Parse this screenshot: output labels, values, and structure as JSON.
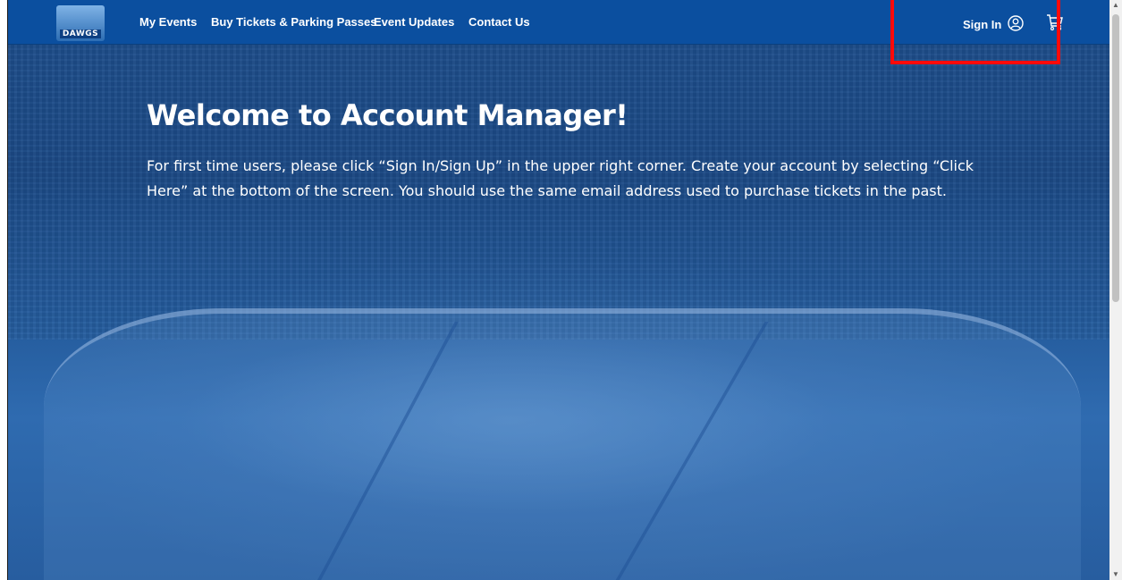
{
  "navbar": {
    "logo_text": "DAWGS",
    "links": [
      "My Events",
      "Buy Tickets & Parking Passes",
      "Event Updates",
      "Contact Us"
    ],
    "sign_in_label": "Sign In",
    "icons": {
      "account": "user-circle-icon",
      "cart": "cart-icon"
    }
  },
  "hero": {
    "title": "Welcome to Account Manager!",
    "description": "For first time users, please click “Sign In/Sign Up” in the upper right corner. Create your account by selecting “Click Here” at the bottom of the screen. You should use the same email address used to purchase tickets in the past."
  },
  "annotation": {
    "highlight_color": "#ff0a0a"
  },
  "colors": {
    "nav_bg": "#0b4f9f",
    "hero_tint": "#1f4f8d"
  }
}
